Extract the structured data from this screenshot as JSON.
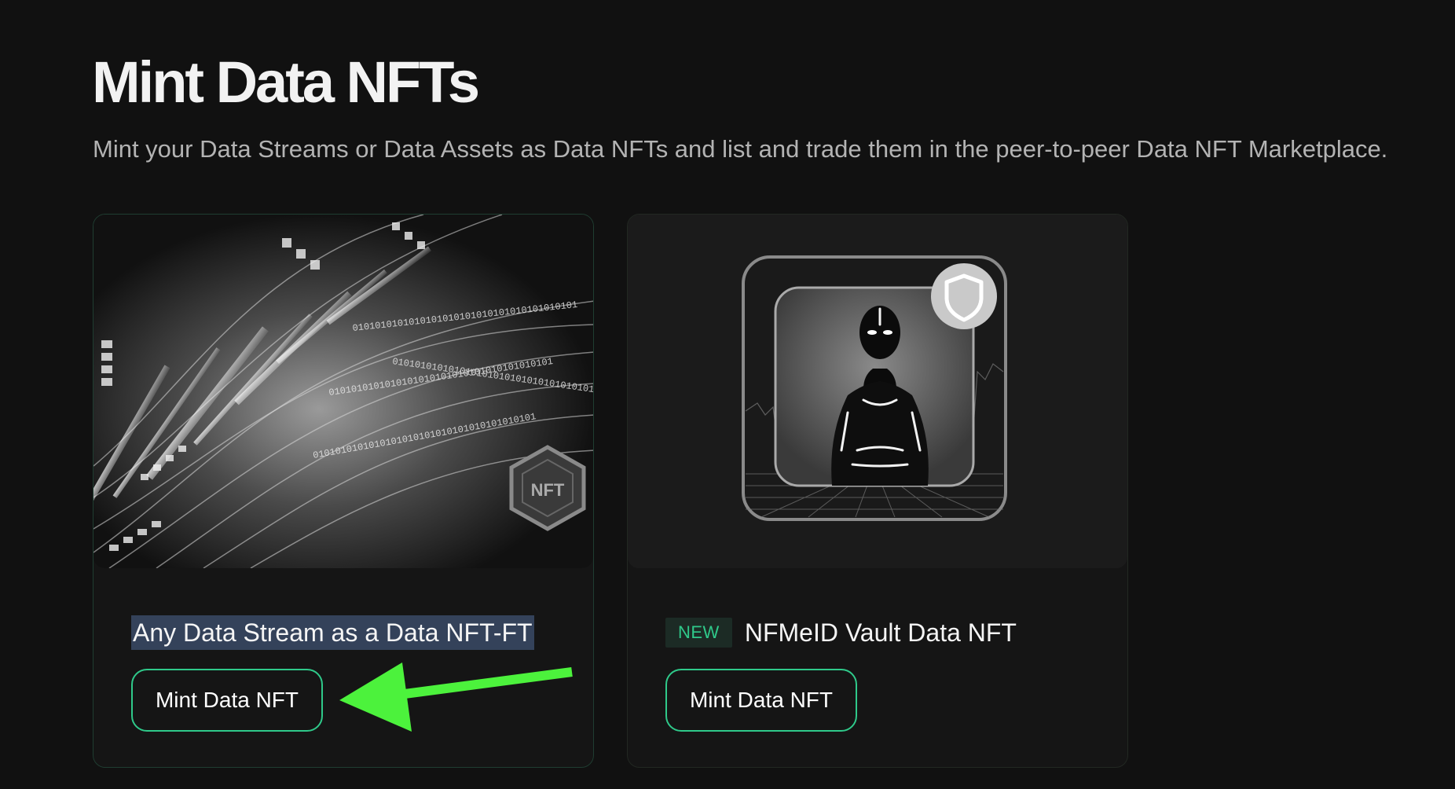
{
  "page": {
    "title": "Mint Data NFTs",
    "subtitle": "Mint your Data Streams or Data Assets as Data NFTs and list and trade them in the peer-to-peer Data NFT Marketplace."
  },
  "cards": [
    {
      "title": "Any Data Stream as a Data NFT-FT",
      "button_label": "Mint Data NFT",
      "image_badge": "NFT",
      "binary_text": "0101010101010101010101010101010101010101"
    },
    {
      "badge": "NEW",
      "title": "NFMeID Vault Data NFT",
      "button_label": "Mint Data NFT"
    }
  ],
  "colors": {
    "background": "#111111",
    "card": "#151515",
    "accent": "#2fc98a",
    "annotation_arrow": "#4cf23c",
    "selection": "#34425a"
  }
}
